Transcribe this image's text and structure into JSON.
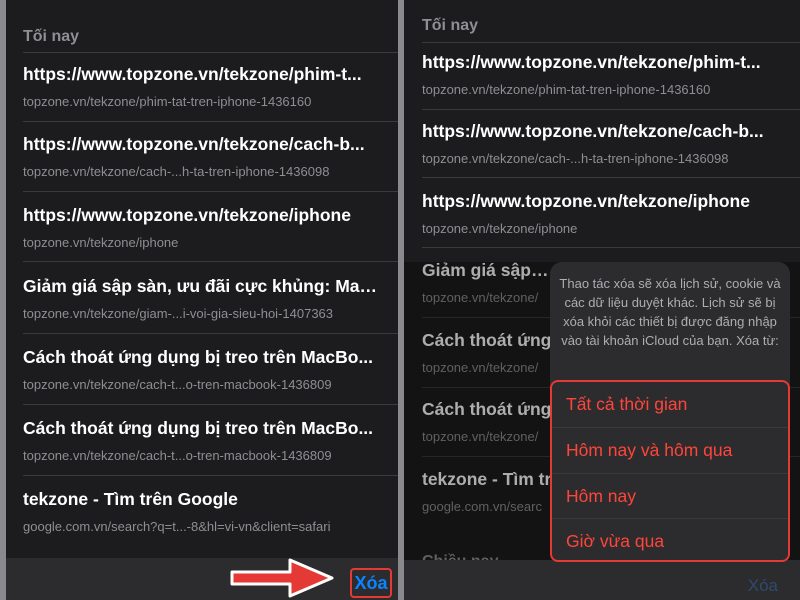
{
  "left": {
    "section_header": "Tối nay",
    "items": [
      {
        "title": "https://www.topzone.vn/tekzone/phim-t...",
        "url": "topzone.vn/tekzone/phim-tat-tren-iphone-1436160"
      },
      {
        "title": "https://www.topzone.vn/tekzone/cach-b...",
        "url": "topzone.vn/tekzone/cach-...h-ta-tren-iphone-1436098"
      },
      {
        "title": "https://www.topzone.vn/tekzone/iphone",
        "url": "topzone.vn/tekzone/iphone"
      },
      {
        "title": "Giảm giá sập sàn, ưu đãi cực khủng: Mac...",
        "url": "topzone.vn/tekzone/giam-...i-voi-gia-sieu-hoi-1407363"
      },
      {
        "title": "Cách thoát ứng dụng bị treo trên MacBo...",
        "url": "topzone.vn/tekzone/cach-t...o-tren-macbook-1436809"
      },
      {
        "title": "Cách thoát ứng dụng bị treo trên MacBo...",
        "url": "topzone.vn/tekzone/cach-t...o-tren-macbook-1436809"
      },
      {
        "title": "tekzone - Tìm trên Google",
        "url": "google.com.vn/search?q=t...-8&hl=vi-vn&client=safari"
      }
    ],
    "clear_label": "Xóa"
  },
  "right": {
    "section_header": "Tối nay",
    "items": [
      {
        "title": "https://www.topzone.vn/tekzone/phim-t...",
        "url": "topzone.vn/tekzone/phim-tat-tren-iphone-1436160"
      },
      {
        "title": "https://www.topzone.vn/tekzone/cach-b...",
        "url": "topzone.vn/tekzone/cach-...h-ta-tren-iphone-1436098"
      },
      {
        "title": "https://www.topzone.vn/tekzone/iphone",
        "url": "topzone.vn/tekzone/iphone"
      },
      {
        "title": "Giảm giá sập sà",
        "url": "topzone.vn/tekzone/"
      },
      {
        "title": "Cách thoát ứng",
        "url": "topzone.vn/tekzone/"
      },
      {
        "title": "Cách thoát ứng",
        "url": "topzone.vn/tekzone/"
      },
      {
        "title": "tekzone - Tìm tr",
        "url": "google.com.vn/searc"
      }
    ],
    "next_section_header": "Chiều nay",
    "clear_label": "Xóa",
    "sheet": {
      "message": "Thao tác xóa sẽ xóa lịch sử, cookie và các dữ liệu duyệt khác. Lịch sử sẽ bị xóa khỏi các thiết bị được đăng nhập vào tài khoản iCloud của bạn. Xóa từ:",
      "options": [
        "Tất cả thời gian",
        "Hôm nay và hôm qua",
        "Hôm nay",
        "Giờ vừa qua"
      ]
    }
  },
  "colors": {
    "background": "#1c1c1e",
    "title_text": "#ffffff",
    "secondary_text": "#8e8e93",
    "accent_blue": "#0a84ff",
    "destructive_red": "#ff453a",
    "annotation_red": "#e53935"
  }
}
